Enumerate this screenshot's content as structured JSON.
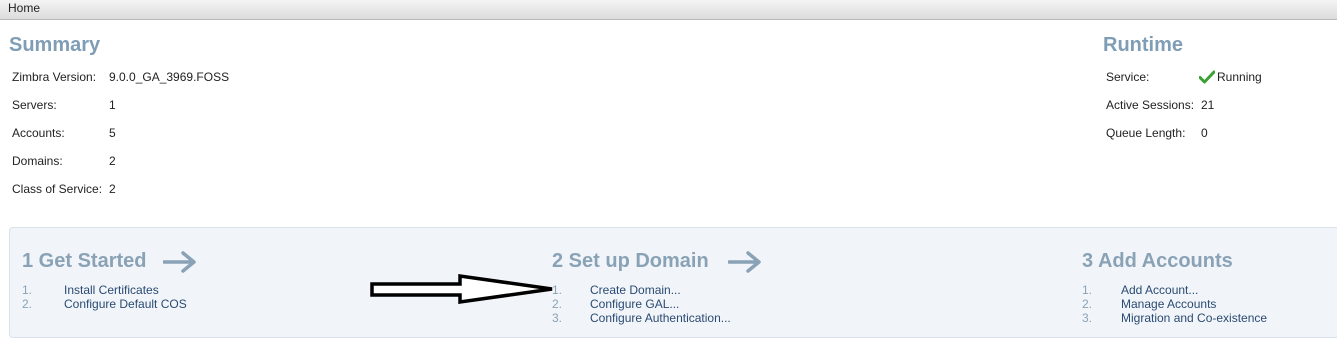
{
  "breadcrumb": {
    "home": "Home"
  },
  "summary": {
    "title": "Summary",
    "rows": [
      {
        "label": "Zimbra Version:",
        "value": "9.0.0_GA_3969.FOSS"
      },
      {
        "label": "Servers:",
        "value": "1"
      },
      {
        "label": "Accounts:",
        "value": "5"
      },
      {
        "label": "Domains:",
        "value": "2"
      },
      {
        "label": "Class of Service:",
        "value": "2"
      }
    ]
  },
  "runtime": {
    "title": "Runtime",
    "rows": [
      {
        "label": "Service:",
        "value": "Running",
        "icon": "check-icon",
        "icon_color": "#3aa135"
      },
      {
        "label": "Active Sessions:",
        "value": "21"
      },
      {
        "label": "Queue Length:",
        "value": "0"
      }
    ]
  },
  "steps": [
    {
      "title": "1 Get Started",
      "items": [
        {
          "num": "1.",
          "label": "Install Certificates"
        },
        {
          "num": "2.",
          "label": "Configure Default COS"
        }
      ]
    },
    {
      "title": "2 Set up Domain",
      "items": [
        {
          "num": "1.",
          "label": "Create Domain..."
        },
        {
          "num": "2.",
          "label": "Configure GAL..."
        },
        {
          "num": "3.",
          "label": "Configure Authentication..."
        }
      ]
    },
    {
      "title": "3 Add Accounts",
      "items": [
        {
          "num": "1.",
          "label": "Add Account..."
        },
        {
          "num": "2.",
          "label": "Manage Accounts"
        },
        {
          "num": "3.",
          "label": "Migration and Co-existence"
        }
      ]
    }
  ],
  "colors": {
    "accent_title": "#7f9db5",
    "link": "#2a4a72",
    "panel_bg": "#f1f5f9"
  }
}
